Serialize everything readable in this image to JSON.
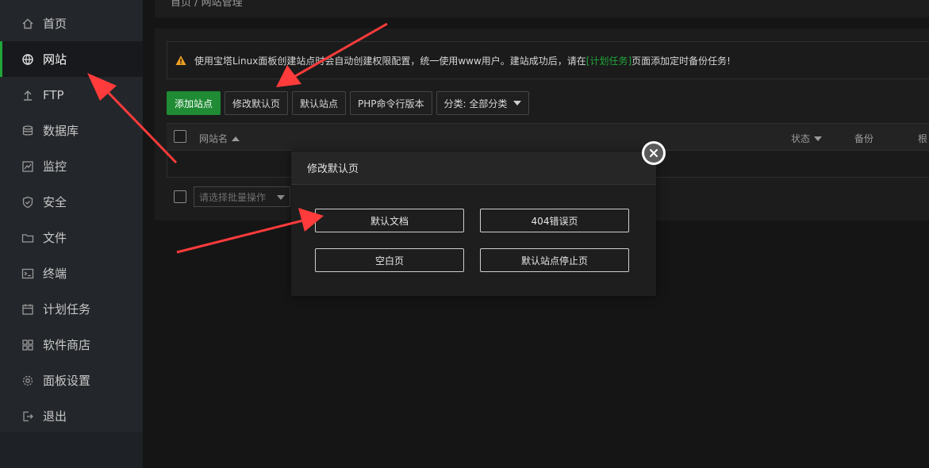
{
  "breadcrumb": "首页  /  网站管理",
  "sidebar": {
    "items": [
      {
        "label": "首页",
        "icon": "home-icon"
      },
      {
        "label": "网站",
        "icon": "globe-icon",
        "active": true
      },
      {
        "label": "FTP",
        "icon": "upload-icon"
      },
      {
        "label": "数据库",
        "icon": "database-icon"
      },
      {
        "label": "监控",
        "icon": "monitor-icon"
      },
      {
        "label": "安全",
        "icon": "shield-icon"
      },
      {
        "label": "文件",
        "icon": "folder-icon"
      },
      {
        "label": "终端",
        "icon": "terminal-icon"
      },
      {
        "label": "计划任务",
        "icon": "calendar-icon"
      },
      {
        "label": "软件商店",
        "icon": "grid-icon"
      },
      {
        "label": "面板设置",
        "icon": "gear-icon"
      },
      {
        "label": "退出",
        "icon": "logout-icon"
      }
    ]
  },
  "alert": {
    "text_before": "使用宝塔Linux面板创建站点时会自动创建权限配置，统一使用www用户。建站成功后，请在",
    "link": "[计划任务]",
    "text_after": "页面添加定时备份任务!"
  },
  "toolbar": {
    "add_site": "添加站点",
    "modify_default": "修改默认页",
    "default_site": "默认站点",
    "php_cli": "PHP命令行版本",
    "category": "分类: 全部分类"
  },
  "table": {
    "col_name": "网站名",
    "col_status": "状态",
    "col_backup": "备份",
    "col_root": "根"
  },
  "batch": {
    "placeholder": "请选择批量操作"
  },
  "modal": {
    "title": "修改默认页",
    "options": [
      "默认文档",
      "404错误页",
      "空白页",
      "默认站点停止页"
    ]
  },
  "colors": {
    "accent": "#20a53a",
    "annotation_arrow": "#ff3b3b",
    "sidebar_bg": "#23262a"
  }
}
